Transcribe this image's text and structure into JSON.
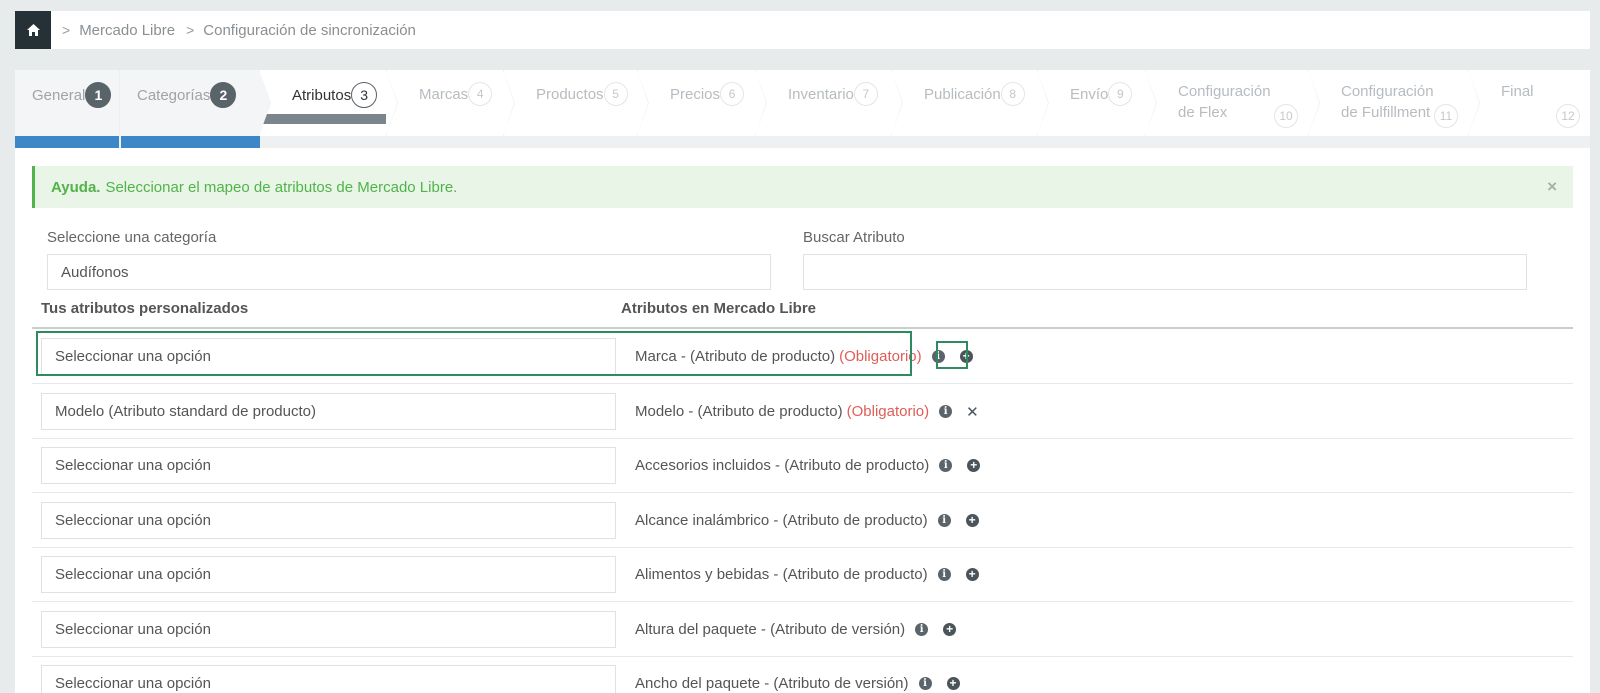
{
  "breadcrumb": {
    "home_icon": "home-icon",
    "items": [
      "Mercado Libre",
      "Configuración de sincronización"
    ],
    "separator": ">"
  },
  "wizard": {
    "steps": [
      {
        "label": "General",
        "num": "1",
        "state": "done"
      },
      {
        "label": "Categorías",
        "num": "2",
        "state": "done"
      },
      {
        "label": "Atributos",
        "num": "3",
        "state": "active"
      },
      {
        "label": "Marcas",
        "num": "4",
        "state": "pending"
      },
      {
        "label": "Productos",
        "num": "5",
        "state": "pending"
      },
      {
        "label": "Precios",
        "num": "6",
        "state": "pending"
      },
      {
        "label": "Inventario",
        "num": "7",
        "state": "pending"
      },
      {
        "label": "Publicación",
        "num": "8",
        "state": "pending"
      },
      {
        "label": "Envío",
        "num": "9",
        "state": "pending"
      },
      {
        "label_line1": "Configuración",
        "label_line2": "de Flex",
        "num": "10",
        "state": "pending"
      },
      {
        "label_line1": "Configuración",
        "label_line2": "de Fulfillment",
        "num": "11",
        "state": "pending"
      },
      {
        "label": "Final",
        "num": "12",
        "state": "pending"
      }
    ]
  },
  "help": {
    "title": "Ayuda.",
    "text": "Seleccionar el mapeo de atributos de Mercado Libre.",
    "close": "×"
  },
  "filters": {
    "category_label": "Seleccione una categoría",
    "category_value": "Audífonos",
    "search_label": "Buscar Atributo",
    "search_value": ""
  },
  "table": {
    "col_custom": "Tus atributos personalizados",
    "col_ml": "Atributos en Mercado Libre",
    "rows": [
      {
        "select": "Seleccionar una opción",
        "attr": "Marca - (Atributo de producto)",
        "required": "(Obligatorio)",
        "action": "plus"
      },
      {
        "select": "Modelo (Atributo standard de producto)",
        "attr": "Modelo - (Atributo de producto)",
        "required": "(Obligatorio)",
        "action": "remove"
      },
      {
        "select": "Seleccionar una opción",
        "attr": "Accesorios incluidos - (Atributo de producto)",
        "required": "",
        "action": "plus"
      },
      {
        "select": "Seleccionar una opción",
        "attr": "Alcance inalámbrico - (Atributo de producto)",
        "required": "",
        "action": "plus"
      },
      {
        "select": "Seleccionar una opción",
        "attr": "Alimentos y bebidas - (Atributo de producto)",
        "required": "",
        "action": "plus"
      },
      {
        "select": "Seleccionar una opción",
        "attr": "Altura del paquete - (Atributo de versión)",
        "required": "",
        "action": "plus"
      },
      {
        "select": "Seleccionar una opción",
        "attr": "Ancho del paquete - (Atributo de versión)",
        "required": "",
        "action": "plus"
      }
    ]
  },
  "colors": {
    "dark_nav": "#253137",
    "progress_done": "#3d87c9",
    "progress_active": "#7a868c",
    "help_green": "#52b34a",
    "required_red": "#e05d57",
    "highlight": "#2e8b5f"
  }
}
